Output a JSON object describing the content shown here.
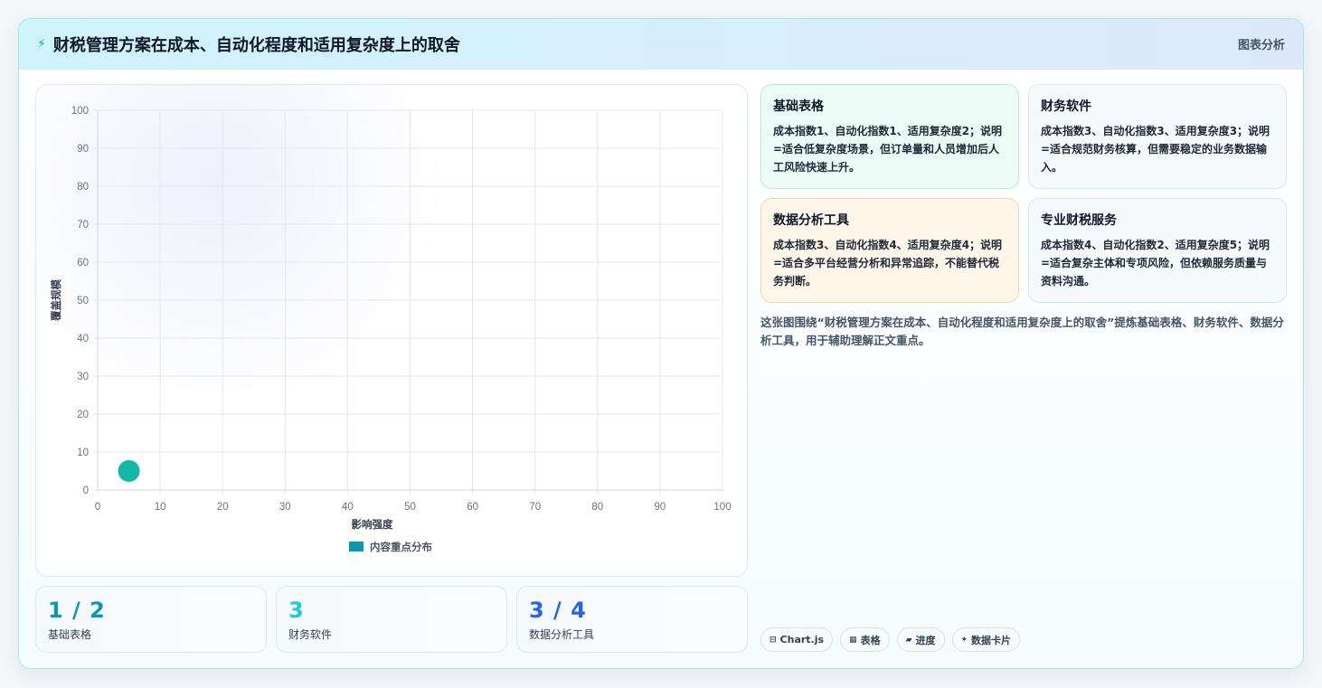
{
  "header": {
    "title": "财税管理方案在成本、自动化程度和适用复杂度上的取舍",
    "tag": "图表分析",
    "icon": "lightning-icon"
  },
  "chart_data": {
    "type": "scatter",
    "xlabel": "影响强度",
    "ylabel": "覆盖规模",
    "xlim": [
      0,
      100
    ],
    "ylim": [
      0,
      100
    ],
    "xticks": [
      0,
      10,
      20,
      30,
      40,
      50,
      60,
      70,
      80,
      90,
      100
    ],
    "yticks": [
      0,
      10,
      20,
      30,
      40,
      50,
      60,
      70,
      80,
      90,
      100
    ],
    "grid": true,
    "legend_position": "bottom",
    "series": [
      {
        "name": "内容重点分布",
        "color": "#14b8a6",
        "legend_color": "#0e97b2",
        "points": [
          {
            "x": 5,
            "y": 5
          }
        ]
      }
    ]
  },
  "stats": [
    {
      "value": "1 / 2",
      "label": "基础表格",
      "color": "#0e97b2"
    },
    {
      "value": "3",
      "label": "财务软件",
      "color": "#22c7dc"
    },
    {
      "value": "3 / 4",
      "label": "数据分析工具",
      "color": "#2563eb"
    }
  ],
  "cards": [
    {
      "title": "基础表格",
      "text": "成本指数1、自动化指数1、适用复杂度2；说明=适合低复杂度场景，但订单量和人员增加后人工风险快速上升。",
      "bg": "#ecfbf5",
      "border": "#b8ecd5"
    },
    {
      "title": "财务软件",
      "text": "成本指数3、自动化指数3、适用复杂度3；说明=适合规范财务核算，但需要稳定的业务数据输入。",
      "bg": "#f6fafc",
      "border": "#d5e9f0"
    },
    {
      "title": "数据分析工具",
      "text": "成本指数3、自动化指数4、适用复杂度4；说明=适合多平台经营分析和异常追踪，不能替代税务判断。",
      "bg": "#fdf6e9",
      "border": "#f2d9ad"
    },
    {
      "title": "专业财税服务",
      "text": "成本指数4、自动化指数2、适用复杂度5；说明=适合复杂主体和专项风险，但依赖服务质量与资料沟通。",
      "bg": "#f6fafc",
      "border": "#d5e9f0"
    }
  ],
  "summary": "这张图围绕“财税管理方案在成本、自动化程度和适用复杂度上的取舍”提炼基础表格、财务软件、数据分析工具，用于辅助理解正文重点。",
  "tags": [
    {
      "icon": "⊟",
      "label": "Chart.js",
      "name": "chartjs"
    },
    {
      "icon": "▦",
      "label": "表格",
      "name": "table"
    },
    {
      "icon": "▰",
      "label": "进度",
      "name": "progress"
    },
    {
      "icon": "✦",
      "label": "数据卡片",
      "name": "data-card"
    }
  ]
}
